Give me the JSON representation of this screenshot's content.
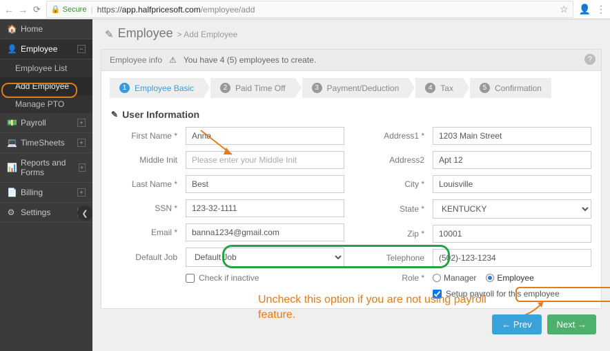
{
  "browser": {
    "secure_label": "Secure",
    "url_scheme": "https://",
    "url_host": "app.halfpricesoft.com",
    "url_path": "/employee/add"
  },
  "sidebar": {
    "items": [
      {
        "icon": "🏠",
        "label": "Home"
      },
      {
        "icon": "👤",
        "label": "Employee",
        "active": true
      },
      {
        "icon": "💵",
        "label": "Payroll"
      },
      {
        "icon": "💻",
        "label": "TimeSheets"
      },
      {
        "icon": "📊",
        "label": "Reports and Forms"
      },
      {
        "icon": "📄",
        "label": "Billing"
      },
      {
        "icon": "⚙",
        "label": "Settings"
      }
    ],
    "sub_employee": [
      {
        "label": "Employee List"
      },
      {
        "label": "Add Employee",
        "current": true
      },
      {
        "label": "Manage PTO"
      }
    ]
  },
  "page": {
    "title": "Employee",
    "crumb": "> Add Employee"
  },
  "alert": {
    "lead": "Employee info",
    "msg": "You have 4 (5) employees to create."
  },
  "steps": [
    {
      "num": "1",
      "label": "Employee Basic",
      "on": true
    },
    {
      "num": "2",
      "label": "Paid Time Off"
    },
    {
      "num": "3",
      "label": "Payment/Deduction"
    },
    {
      "num": "4",
      "label": "Tax"
    },
    {
      "num": "5",
      "label": "Confirmation"
    }
  ],
  "section": {
    "title": "User Information"
  },
  "form": {
    "first_name_label": "First Name *",
    "first_name": "Anna",
    "middle_label": "Middle Init",
    "middle_placeholder": "Please enter your Middle Init",
    "middle": "",
    "last_name_label": "Last Name *",
    "last_name": "Best",
    "ssn_label": "SSN *",
    "ssn": "123-32-1111",
    "email_label": "Email *",
    "email": "banna1234@gmail.com",
    "default_job_label": "Default Job",
    "default_job": "Default Job",
    "inactive_label": "Check if inactive",
    "addr1_label": "Address1 *",
    "addr1": "1203 Main Street",
    "addr2_label": "Address2",
    "addr2": "Apt 12",
    "city_label": "City *",
    "city": "Louisville",
    "state_label": "State *",
    "state": "KENTUCKY",
    "zip_label": "Zip *",
    "zip": "10001",
    "tel_label": "Telephone",
    "tel": "(502)-123-1234",
    "role_label": "Role *",
    "role_manager": "Manager",
    "role_employee": "Employee",
    "payroll_label": "Setup payroll for this employee"
  },
  "buttons": {
    "prev": "Prev",
    "next": "Next"
  },
  "annotations": {
    "tip": "Uncheck this option if you are not using payroll feature."
  }
}
